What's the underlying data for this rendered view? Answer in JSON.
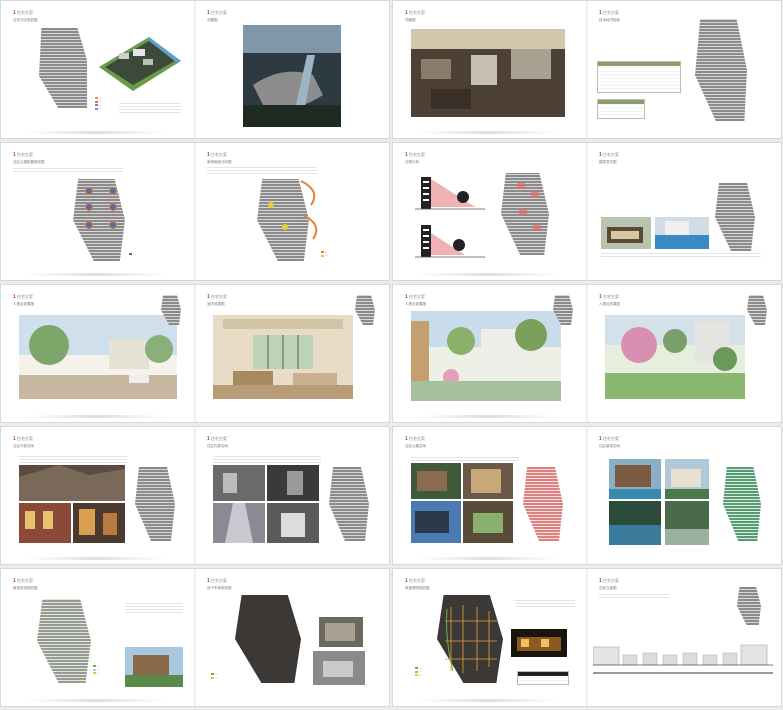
{
  "pages": [
    {
      "header": "住宅方案",
      "caption": "住宅分区规划图"
    },
    {
      "header": "住宅方案",
      "caption": "鸟瞰图"
    },
    {
      "header": "住宅方案",
      "caption": "鸟瞰图"
    },
    {
      "header": "住宅方案",
      "caption": "技术经济指标"
    },
    {
      "header": "住宅方案",
      "caption": "住区公建配套规划图"
    },
    {
      "header": "住宅方案",
      "caption": "景观轴线分析图"
    },
    {
      "header": "住宅方案",
      "caption": "日照分析"
    },
    {
      "header": "住宅方案",
      "caption": "建筑意向图"
    },
    {
      "header": "住宅方案",
      "caption": "人视点效果图"
    },
    {
      "header": "住宅方案",
      "caption": "室内效果图"
    },
    {
      "header": "住宅方案",
      "caption": "人视点效果图"
    },
    {
      "header": "住宅方案",
      "caption": "人视点效果图"
    },
    {
      "header": "住宅方案",
      "caption": "住区外部空间"
    },
    {
      "header": "住宅方案",
      "caption": "住区内部空间"
    },
    {
      "header": "住宅方案",
      "caption": "住区公建空间"
    },
    {
      "header": "住宅方案",
      "caption": "住区景观空间"
    },
    {
      "header": "住宅方案",
      "caption": "景观系统规划图"
    },
    {
      "header": "住宅方案",
      "caption": "地下车库规划图"
    },
    {
      "header": "住宅方案",
      "caption": "夜景照明规划图"
    },
    {
      "header": "住宅方案",
      "caption": "沿街立面图"
    }
  ],
  "colors": {
    "accent": "#c23a4c",
    "background": "#ececec",
    "page": "#ffffff"
  }
}
